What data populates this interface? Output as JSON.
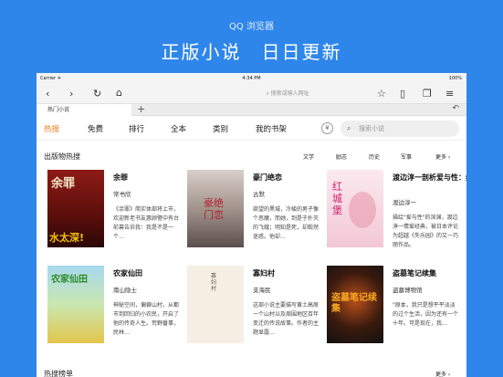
{
  "promo": {
    "brand": "QQ 浏览器",
    "slogan": "正版小说　日日更新"
  },
  "status": {
    "carrier": "Carrier ✈",
    "time": "4:34 PM",
    "battery": "100%"
  },
  "browser": {
    "address_placeholder": "搜索或输入网址"
  },
  "tabs": {
    "active_label": "热门小说"
  },
  "nav": {
    "items": [
      "热搜",
      "免费",
      "排行",
      "全本",
      "类别",
      "我的书架"
    ],
    "search_placeholder": "搜索小说"
  },
  "section1": {
    "title": "出版物热搜",
    "filters": [
      "文学",
      "励志",
      "历史",
      "军事"
    ],
    "more": "更多 ›"
  },
  "books": [
    {
      "title": "余罪",
      "author": "常书欣",
      "desc": "《余罪》简实体部将上市，欢迎新老书友惠顾警中有台前幕告诉我：我是不是一个…",
      "cover_text": "余罪",
      "cover_sub": "水太深!"
    },
    {
      "title": "豪门绝恋",
      "author": "古默",
      "desc": "欲望的黑城，冷峻的男子像个恶魔，而她，到是于扑灭的飞蛾；明知是死，却毅然迷惑。他却…",
      "cover_text": "豪绝门恋"
    },
    {
      "title": "渡边淳一剖析爱与性：红城堡",
      "author": "渡边淳一",
      "desc": "描绘\"爱与性\"的深渊，渡边淳一情爱经典，被日本评论为超越《失乐园》的又一巧丽作品。",
      "cover_text": "红城堡"
    },
    {
      "title": "农家仙田",
      "author": "南山隐士",
      "desc": "神秘空间，偏僻山村，从都市到回归的小农民，开启了他的传奇人生。荒野番事，民林…",
      "cover_text": "农家仙田"
    },
    {
      "title": "寡妇村",
      "author": "支海民",
      "desc": "这部小说主要描写黄土高原一个山村以及周围地区百年变迁的传说故事。作者的主题显露…",
      "cover_text": "寡妇村"
    },
    {
      "title": "盗墓笔记续集",
      "author": "盗墓博物馆",
      "desc": "\"原本，我只是想平平淡淡的过个生活，因为还有一个十年。可是现在，我…",
      "cover_text": "盗墓笔记续集"
    }
  ],
  "section2": {
    "title": "热搜榜单",
    "more": "更多 ›"
  },
  "colors": {
    "accent": "#f07b1f",
    "background": "#2f86ea"
  }
}
